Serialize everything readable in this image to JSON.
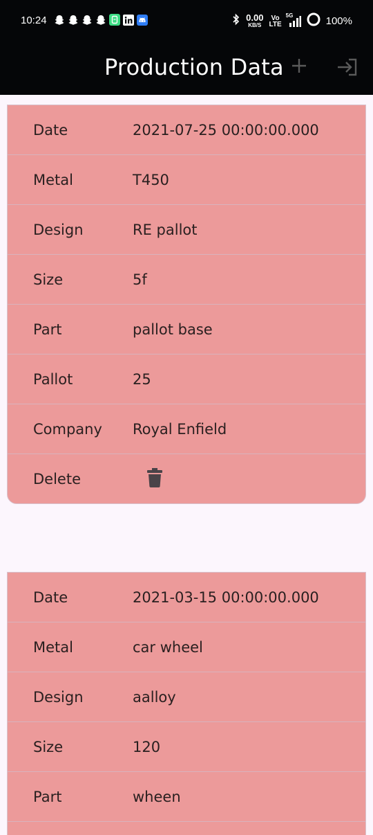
{
  "status_bar": {
    "time": "10:24",
    "speed_value": "0.00",
    "speed_unit": "KB/S",
    "volte_top": "Vo",
    "volte_bottom": "LTE",
    "network": "5G",
    "battery": "100%"
  },
  "app_bar": {
    "title": "Production Data",
    "add_icon": "plus-icon",
    "logout_icon": "logout-icon"
  },
  "records": [
    {
      "date_label": "Date",
      "date": "2021-07-25 00:00:00.000",
      "metal_label": "Metal",
      "metal": "T450",
      "design_label": "Design",
      "design": "RE pallot",
      "size_label": "Size",
      "size": "5f",
      "part_label": "Part",
      "part": "pallot base",
      "pallot_label": "Pallot",
      "pallot": "25",
      "company_label": "Company",
      "company": "Royal Enfield",
      "delete_label": "Delete"
    },
    {
      "date_label": "Date",
      "date": "2021-03-15 00:00:00.000",
      "metal_label": "Metal",
      "metal": "car wheel",
      "design_label": "Design",
      "design": "aalloy",
      "size_label": "Size",
      "size": "120",
      "part_label": "Part",
      "part": "wheen"
    }
  ],
  "colors": {
    "app_bar": "#050608",
    "card": "#ec9a9a",
    "background": "#fcf6fd",
    "icon_dim": "#5a5a5a"
  }
}
